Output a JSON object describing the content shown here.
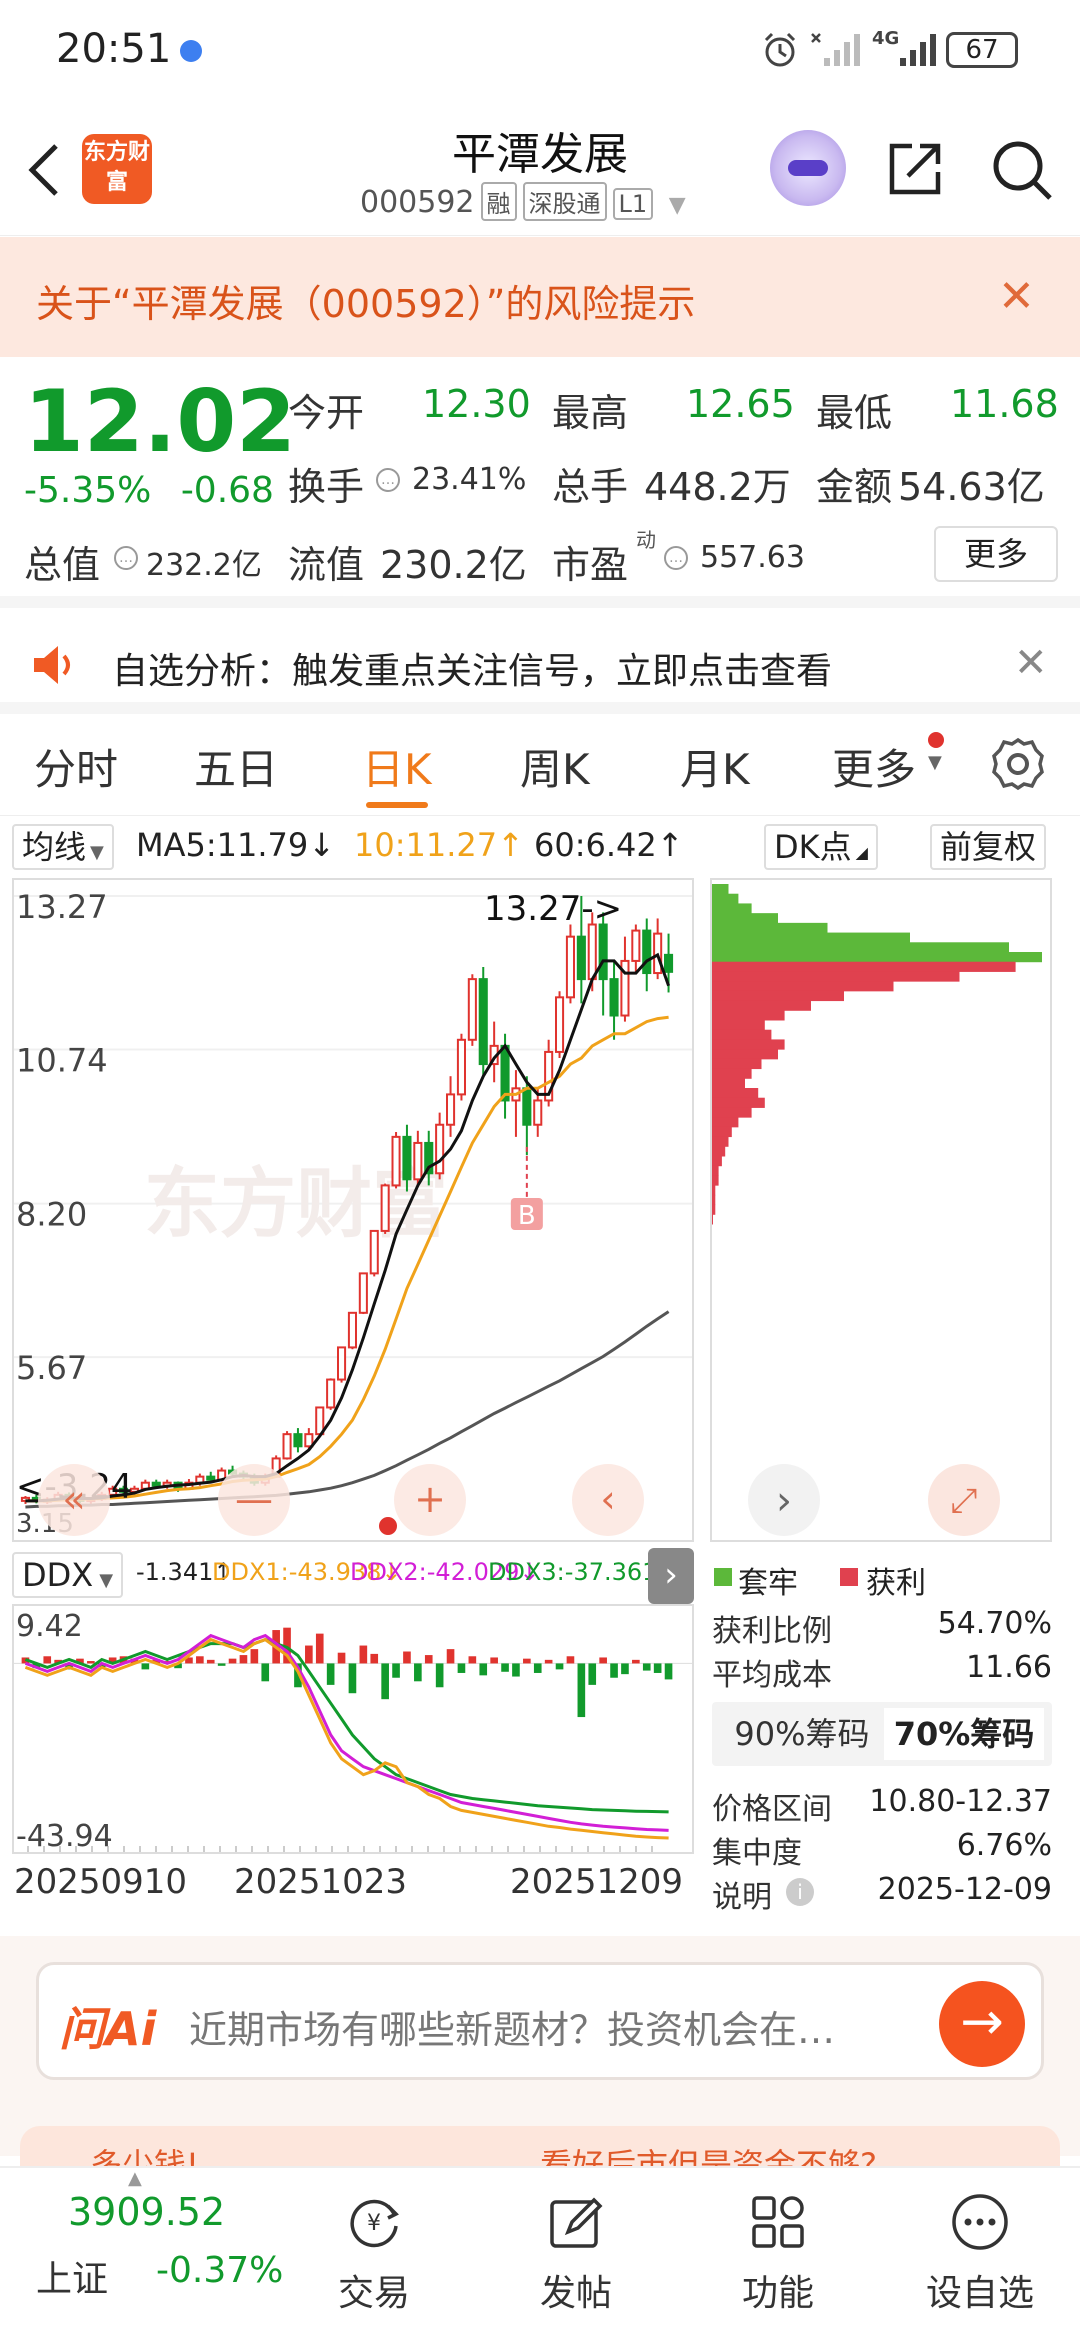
{
  "status_bar": {
    "time": "20:51",
    "network": "4G",
    "battery": "67"
  },
  "header": {
    "logo_text": "东方财富",
    "stock_name": "平潭发展",
    "stock_code": "000592",
    "tags": [
      "融",
      "深股通",
      "L1"
    ]
  },
  "risk_banner": {
    "text": "关于“平潭发展（000592）”的风险提示"
  },
  "quote": {
    "price": "12.02",
    "change_pct": "-5.35%",
    "change_amt": "-0.68",
    "open_label": "今开",
    "open": "12.30",
    "high_label": "最高",
    "high": "12.65",
    "low_label": "最低",
    "low": "11.68",
    "turnover_label": "换手",
    "turnover": "23.41%",
    "volume_label": "总手",
    "volume": "448.2万",
    "amount_label": "金额",
    "amount": "54.63亿",
    "mktcap_label": "总值",
    "mktcap": "232.2亿",
    "float_label": "流值",
    "float_cap": "230.2亿",
    "pe_label": "市盈",
    "pe_sup": "动",
    "pe": "557.63",
    "more_label": "更多"
  },
  "notice": {
    "text": "自选分析：触发重点关注信号，立即点击查看"
  },
  "tabs": [
    {
      "label": "分时"
    },
    {
      "label": "五日"
    },
    {
      "label": "日K"
    },
    {
      "label": "周K"
    },
    {
      "label": "月K"
    },
    {
      "label": "更多"
    }
  ],
  "active_tab": "日K",
  "chart_toolbar": {
    "ma_select": "均线",
    "ma5": "MA5:11.79↓",
    "ma10": "10:11.27↑",
    "ma60": "60:6.42↑",
    "dk_label": "DK点",
    "adjust_label": "前复权"
  },
  "watermark": "东方财富",
  "colors": {
    "up": "#e0332e",
    "down": "#119a2c",
    "accent": "#f07a1a",
    "ma10": "#f0a21a",
    "ddx2": "#d21fd6"
  },
  "chart_data": {
    "type": "candlestick",
    "ylim": [
      3.15,
      13.27
    ],
    "y_ticks": [
      "13.27",
      "10.74",
      "8.20",
      "5.67"
    ],
    "max_label": "13.27->",
    "min_label": "<-3.24",
    "bottom_label": "3.15",
    "marker_label": "B",
    "candles": [
      [
        3.3,
        3.35,
        3.25,
        3.38
      ],
      [
        3.35,
        3.3,
        3.26,
        3.4
      ],
      [
        3.3,
        3.32,
        3.25,
        3.36
      ],
      [
        3.32,
        3.4,
        3.3,
        3.45
      ],
      [
        3.4,
        3.36,
        3.3,
        3.44
      ],
      [
        3.36,
        3.3,
        3.26,
        3.4
      ],
      [
        3.3,
        3.33,
        3.25,
        3.36
      ],
      [
        3.33,
        3.4,
        3.3,
        3.45
      ],
      [
        3.4,
        3.5,
        3.38,
        3.55
      ],
      [
        3.5,
        3.45,
        3.4,
        3.55
      ],
      [
        3.45,
        3.5,
        3.42,
        3.55
      ],
      [
        3.5,
        3.6,
        3.48,
        3.65
      ],
      [
        3.6,
        3.55,
        3.5,
        3.65
      ],
      [
        3.55,
        3.6,
        3.5,
        3.65
      ],
      [
        3.6,
        3.5,
        3.45,
        3.62
      ],
      [
        3.5,
        3.6,
        3.48,
        3.66
      ],
      [
        3.6,
        3.7,
        3.55,
        3.75
      ],
      [
        3.7,
        3.65,
        3.6,
        3.78
      ],
      [
        3.65,
        3.8,
        3.62,
        3.85
      ],
      [
        3.8,
        3.75,
        3.7,
        3.88
      ],
      [
        3.75,
        3.7,
        3.65,
        3.8
      ],
      [
        3.7,
        3.6,
        3.55,
        3.75
      ],
      [
        3.6,
        3.7,
        3.55,
        3.75
      ],
      [
        3.7,
        4.0,
        3.68,
        4.05
      ],
      [
        4.0,
        4.4,
        3.98,
        4.45
      ],
      [
        4.4,
        4.2,
        4.1,
        4.5
      ],
      [
        4.2,
        4.4,
        4.15,
        4.5
      ],
      [
        4.4,
        4.84,
        4.38,
        4.84
      ],
      [
        4.84,
        5.3,
        4.8,
        5.32
      ],
      [
        5.3,
        5.83,
        5.25,
        5.83
      ],
      [
        5.83,
        6.4,
        5.8,
        6.41
      ],
      [
        6.4,
        7.05,
        6.38,
        7.05
      ],
      [
        7.05,
        7.75,
        7.0,
        7.76
      ],
      [
        7.75,
        8.5,
        7.7,
        8.53
      ],
      [
        8.5,
        9.3,
        8.45,
        9.38
      ],
      [
        9.3,
        8.6,
        8.4,
        9.5
      ],
      [
        8.6,
        9.2,
        8.5,
        9.4
      ],
      [
        9.2,
        8.7,
        8.5,
        9.4
      ],
      [
        8.7,
        9.5,
        8.6,
        9.7
      ],
      [
        9.5,
        10.0,
        9.3,
        10.3
      ],
      [
        10.0,
        10.9,
        9.9,
        11.0
      ],
      [
        10.9,
        11.9,
        10.8,
        11.98
      ],
      [
        11.9,
        10.5,
        10.3,
        12.1
      ],
      [
        10.5,
        10.8,
        10.2,
        11.2
      ],
      [
        10.8,
        9.9,
        9.6,
        11.0
      ],
      [
        9.9,
        10.1,
        9.3,
        10.4
      ],
      [
        10.1,
        9.5,
        9.0,
        10.3
      ],
      [
        9.5,
        9.9,
        9.3,
        10.1
      ],
      [
        9.9,
        10.7,
        9.8,
        10.9
      ],
      [
        10.7,
        11.6,
        10.6,
        11.7
      ],
      [
        11.6,
        12.6,
        11.5,
        12.8
      ],
      [
        12.6,
        11.9,
        11.5,
        13.27
      ],
      [
        11.9,
        12.8,
        11.7,
        13.0
      ],
      [
        12.8,
        11.9,
        11.3,
        13.0
      ],
      [
        11.9,
        11.3,
        10.9,
        12.2
      ],
      [
        11.3,
        12.2,
        11.2,
        12.6
      ],
      [
        12.2,
        12.7,
        12.0,
        12.8
      ],
      [
        12.7,
        12.0,
        11.7,
        12.9
      ],
      [
        12.0,
        12.65,
        11.9,
        12.9
      ],
      [
        12.3,
        12.02,
        11.68,
        12.65
      ]
    ],
    "ma5": [
      3.3,
      3.3,
      3.31,
      3.33,
      3.35,
      3.34,
      3.34,
      3.35,
      3.38,
      3.4,
      3.43,
      3.49,
      3.52,
      3.54,
      3.56,
      3.57,
      3.59,
      3.61,
      3.65,
      3.7,
      3.72,
      3.7,
      3.7,
      3.75,
      3.88,
      4.0,
      4.14,
      4.37,
      4.63,
      5.0,
      5.46,
      5.99,
      6.55,
      7.1,
      7.7,
      8.1,
      8.5,
      8.8,
      8.9,
      9.1,
      9.4,
      9.9,
      10.3,
      10.6,
      10.8,
      10.5,
      10.2,
      10.0,
      10.0,
      10.4,
      10.9,
      11.4,
      11.9,
      12.2,
      12.2,
      12.0,
      12.0,
      12.2,
      12.3,
      11.79
    ],
    "ma10": [
      3.3,
      3.3,
      3.3,
      3.31,
      3.32,
      3.33,
      3.33,
      3.34,
      3.35,
      3.36,
      3.38,
      3.41,
      3.44,
      3.47,
      3.49,
      3.5,
      3.52,
      3.55,
      3.58,
      3.62,
      3.64,
      3.65,
      3.66,
      3.7,
      3.77,
      3.83,
      3.9,
      4.03,
      4.2,
      4.4,
      4.63,
      4.97,
      5.36,
      5.8,
      6.3,
      6.8,
      7.2,
      7.6,
      8.0,
      8.4,
      8.8,
      9.2,
      9.5,
      9.8,
      10.0,
      10.0,
      10.1,
      10.1,
      10.2,
      10.3,
      10.5,
      10.6,
      10.8,
      10.9,
      11.0,
      11.0,
      11.1,
      11.2,
      11.25,
      11.27
    ],
    "ma60": [
      3.2,
      3.21,
      3.21,
      3.22,
      3.22,
      3.23,
      3.23,
      3.24,
      3.24,
      3.25,
      3.26,
      3.27,
      3.28,
      3.29,
      3.3,
      3.31,
      3.32,
      3.33,
      3.34,
      3.35,
      3.36,
      3.37,
      3.38,
      3.39,
      3.41,
      3.43,
      3.45,
      3.48,
      3.51,
      3.55,
      3.6,
      3.66,
      3.72,
      3.8,
      3.88,
      3.97,
      4.06,
      4.15,
      4.25,
      4.34,
      4.44,
      4.54,
      4.64,
      4.74,
      4.83,
      4.92,
      5.01,
      5.1,
      5.19,
      5.28,
      5.38,
      5.48,
      5.58,
      5.68,
      5.8,
      5.92,
      6.05,
      6.18,
      6.3,
      6.42
    ],
    "ddx": {
      "select": "DDX",
      "ddx": "-1.341↑",
      "ddx1": "DDX1:-43.938↓",
      "ddx2": "DDX2:-42.029↓",
      "ddx3": "DDX3:-37.361↓",
      "y_top": "9.42",
      "y_bottom": "-43.94",
      "ylim": [
        -43.94,
        9.42
      ],
      "bars": [
        0.5,
        -0.4,
        0.6,
        0.3,
        -0.5,
        0.4,
        0.2,
        -0.3,
        0.5,
        0.6,
        0.4,
        -0.5,
        0.3,
        0.2,
        -0.4,
        0.5,
        0.6,
        0.3,
        -0.2,
        0.4,
        0.7,
        1.2,
        -1.5,
        2.8,
        3.0,
        -2.0,
        1.5,
        2.5,
        -1.8,
        0.9,
        -2.5,
        1.5,
        0.8,
        -3.0,
        -1.2,
        1.0,
        -1.5,
        0.7,
        -2.0,
        1.2,
        -0.8,
        0.6,
        -1.0,
        0.5,
        -0.7,
        -1.1,
        0.4,
        -0.8,
        0.3,
        -0.5,
        0.6,
        -4.5,
        -1.8,
        0.5,
        -1.2,
        -0.9,
        0.3,
        -0.6,
        -0.8,
        -1.341
      ],
      "ddx1_line": [
        -1,
        -2,
        -3,
        -2,
        -1,
        -2,
        -3,
        -1,
        -2,
        -1,
        0,
        1,
        0,
        -1,
        0,
        2,
        4,
        6,
        5,
        4,
        3,
        5,
        6,
        4,
        2,
        -2,
        -8,
        -14,
        -20,
        -24,
        -26,
        -28,
        -27,
        -25,
        -26,
        -30,
        -31,
        -33,
        -34,
        -36,
        -37,
        -37.5,
        -38,
        -38.5,
        -39,
        -39.5,
        -40,
        -40.5,
        -41,
        -41.3,
        -41.7,
        -42,
        -42.3,
        -42.6,
        -42.9,
        -43.2,
        -43.5,
        -43.7,
        -43.85,
        -43.938
      ],
      "ddx2_line": [
        0,
        -1,
        -2,
        -1,
        0,
        -1,
        -2,
        0,
        -1,
        0,
        1,
        2,
        1,
        0,
        1,
        3,
        5,
        7,
        6,
        5,
        4,
        6,
        7,
        5,
        3,
        -1,
        -6,
        -12,
        -18,
        -22,
        -24,
        -26,
        -27,
        -28,
        -29,
        -30,
        -31,
        -32,
        -33,
        -34,
        -35,
        -35.5,
        -36,
        -36.5,
        -37,
        -37.5,
        -38,
        -38.5,
        -39,
        -39.5,
        -40,
        -40.4,
        -40.7,
        -41,
        -41.2,
        -41.4,
        -41.6,
        -41.8,
        -41.9,
        -42.029
      ],
      "ddx3_line": [
        1,
        0,
        -1,
        0,
        1,
        0,
        -1,
        1,
        0,
        1,
        2,
        3,
        2,
        1,
        2,
        3,
        4,
        5,
        5,
        5,
        4,
        5,
        6,
        5,
        4,
        2,
        -2,
        -6,
        -10,
        -14,
        -18,
        -21,
        -24,
        -26,
        -28,
        -29,
        -30,
        -31,
        -32,
        -33,
        -33.5,
        -34,
        -34.3,
        -34.6,
        -34.9,
        -35.2,
        -35.5,
        -35.8,
        -36,
        -36.2,
        -36.4,
        -36.6,
        -36.8,
        -36.9,
        -37,
        -37.1,
        -37.2,
        -37.25,
        -37.3,
        -37.361
      ]
    },
    "dates": [
      "20250910",
      "20251023",
      "20251209"
    ]
  },
  "chip_panel": {
    "legend_trapped": "套牢",
    "legend_profit": "获利",
    "profit_ratio_label": "获利比例",
    "profit_ratio": "54.70%",
    "avg_cost_label": "平均成本",
    "avg_cost": "11.66",
    "seg_90": "90%筹码",
    "seg_70": "70%筹码",
    "price_range_label": "价格区间",
    "price_range": "10.80-12.37",
    "concentration_label": "集中度",
    "concentration": "6.76%",
    "note_label": "说明",
    "note_date": "2025-12-09",
    "dist": [
      0.05,
      0.08,
      0.12,
      0.2,
      0.35,
      0.6,
      0.9,
      1.0,
      0.92,
      0.75,
      0.55,
      0.4,
      0.3,
      0.22,
      0.16,
      0.18,
      0.22,
      0.2,
      0.15,
      0.12,
      0.1,
      0.14,
      0.16,
      0.12,
      0.08,
      0.06,
      0.05,
      0.04,
      0.03,
      0.02,
      0.02,
      0.01,
      0.01,
      0.01,
      0.0
    ]
  },
  "ai_bar": {
    "logo": "问Ai",
    "placeholder": "近期市场有哪些新题材？投资机会在…"
  },
  "peek_bar": {
    "left": "多少钱!",
    "right": "看好后市但是资金不够?"
  },
  "bottom_nav": {
    "index_value": "3909.52",
    "index_name": "上证",
    "index_change": "-0.37%",
    "items": [
      {
        "label": "交易",
        "icon": "trade-icon"
      },
      {
        "label": "发帖",
        "icon": "post-icon"
      },
      {
        "label": "功能",
        "icon": "apps-icon"
      },
      {
        "label": "设自选",
        "icon": "more-dots-icon"
      }
    ]
  }
}
